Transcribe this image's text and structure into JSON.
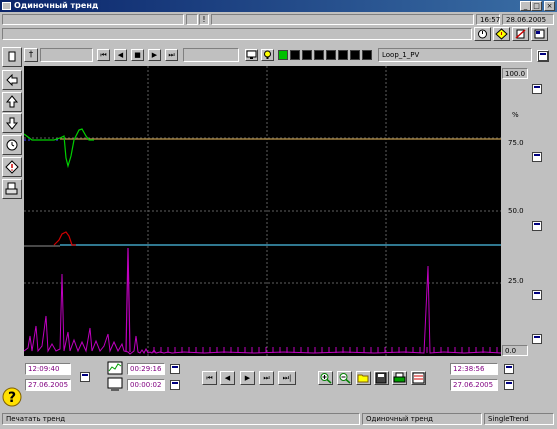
{
  "window": {
    "title": "Одиночный тренд"
  },
  "info_bar": {
    "separator_glyph": "!",
    "time": "16:57",
    "date": "28.06.2005"
  },
  "trend_toolbar": {
    "tag_name": "Loop_1_PV",
    "nav": [
      "⏮",
      "◀",
      "■",
      "▶",
      "⏭"
    ],
    "swatches": [
      "#00c000",
      "#000000",
      "#000000",
      "#000000",
      "#000000",
      "#000000",
      "#000000",
      "#000000"
    ]
  },
  "y_axis": {
    "top": "100.0",
    "unit": "%",
    "ticks": [
      "75.0",
      "50.0",
      "25.0"
    ],
    "bottom": "0.0"
  },
  "bottom": {
    "start_time": "12:09:40",
    "start_date": "27.06.2005",
    "span": "00:29:16",
    "interval": "00:00:02",
    "nav": [
      "⏮",
      "◀",
      "▶",
      "⏭",
      "⏭|"
    ],
    "end_time": "12:38:56",
    "end_date": "27.06.2005"
  },
  "status_bar": {
    "left": "Печатать тренд",
    "center": "Одиночный тренд",
    "right": "SingleTrend"
  },
  "left_tools": [
    "document-icon",
    "back-arrow-icon",
    "up-arrow-icon",
    "down-arrow-icon",
    "alarm-clock-icon",
    "alarm-diamond-icon",
    "print-icon",
    "help-icon"
  ]
}
